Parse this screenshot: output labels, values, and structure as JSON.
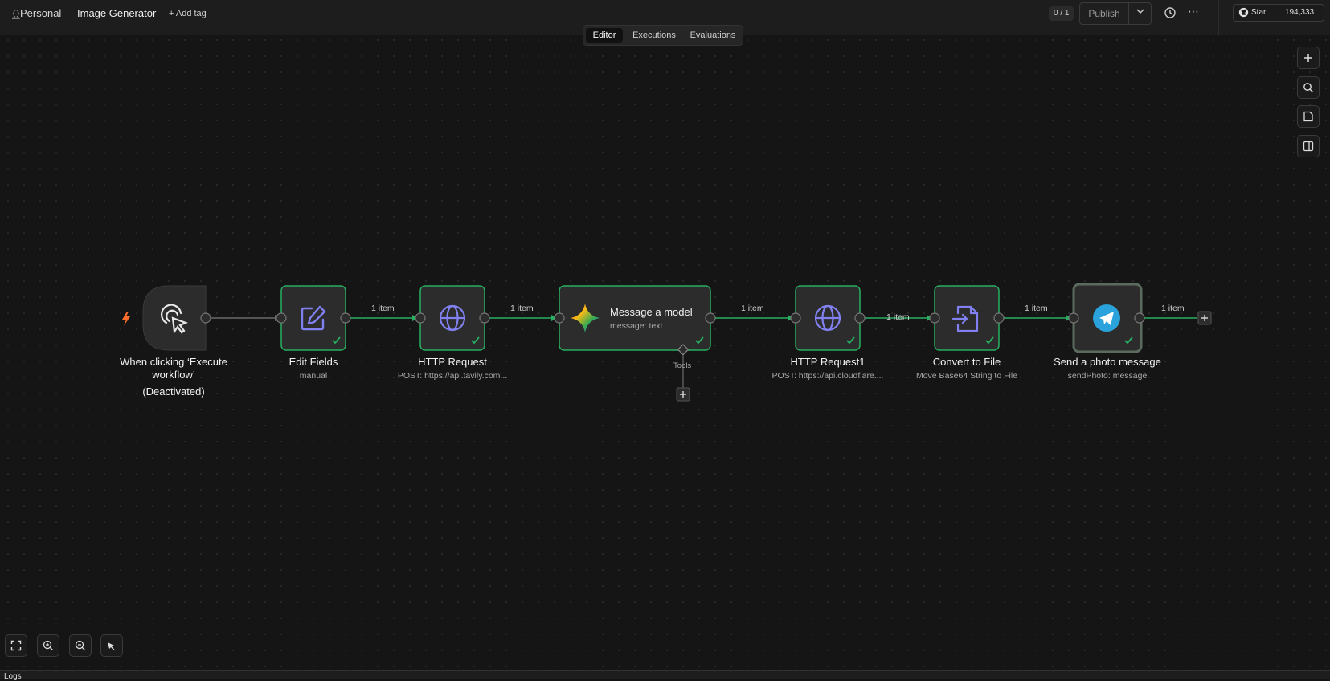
{
  "header": {
    "project": "Personal",
    "workflow_name": "Image Generator",
    "add_tag": "+ Add tag",
    "counter": "0 / 1",
    "publish": "Publish",
    "github_star": "Star",
    "github_count": "194,333"
  },
  "tabs": [
    "Editor",
    "Executions",
    "Evaluations"
  ],
  "nodes": [
    {
      "title": "When clicking ‘Execute workflow’",
      "subtitle": "(Deactivated)"
    },
    {
      "title": "Edit Fields",
      "subtitle": "manual"
    },
    {
      "title": "HTTP Request",
      "subtitle": "POST: https://api.tavily.com..."
    },
    {
      "title": "Message a model",
      "subtitle": "message: text"
    },
    {
      "title": "HTTP Request1",
      "subtitle": "POST: https://api.cloudflare...."
    },
    {
      "title": "Convert to File",
      "subtitle": "Move Base64 String to File"
    },
    {
      "title": "Send a photo message",
      "subtitle": "sendPhoto: message"
    }
  ],
  "edge_label": "1 item",
  "tools_label": "Tools",
  "logs_label": "Logs",
  "colors": {
    "success": "#27ae60",
    "icon": "#7b7bea",
    "trigger": "#ff6d2d",
    "telegram": "#2aa3dc"
  }
}
